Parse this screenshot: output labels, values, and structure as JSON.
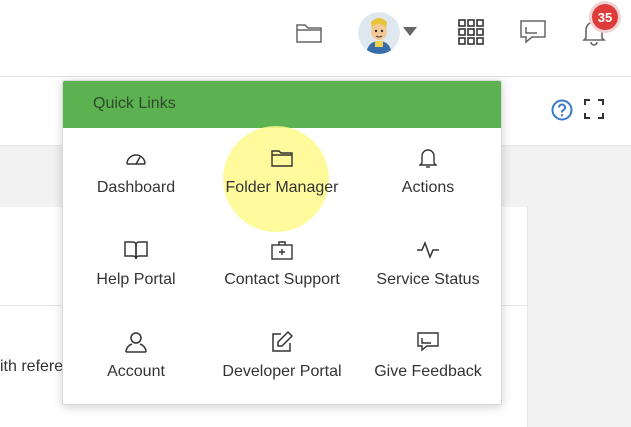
{
  "header": {
    "notification_count": "35"
  },
  "quick_links": {
    "title": "Quick Links",
    "items": [
      {
        "label": "Dashboard",
        "icon": "gauge-icon"
      },
      {
        "label": "Folder Manager",
        "icon": "folder-icon"
      },
      {
        "label": "Actions",
        "icon": "bell-icon"
      },
      {
        "label": "Help Portal",
        "icon": "book-icon"
      },
      {
        "label": "Contact Support",
        "icon": "first-aid-icon"
      },
      {
        "label": "Service Status",
        "icon": "pulse-icon"
      },
      {
        "label": "Account",
        "icon": "user-icon"
      },
      {
        "label": "Developer Portal",
        "icon": "edit-icon"
      },
      {
        "label": "Give Feedback",
        "icon": "chat-icon"
      }
    ]
  },
  "content": {
    "snippet": "ith refere"
  },
  "colors": {
    "header_green": "#5cb150",
    "badge_red": "#e03b3b",
    "help_blue": "#3a78c9",
    "highlight_yellow": "#fffa8c"
  }
}
